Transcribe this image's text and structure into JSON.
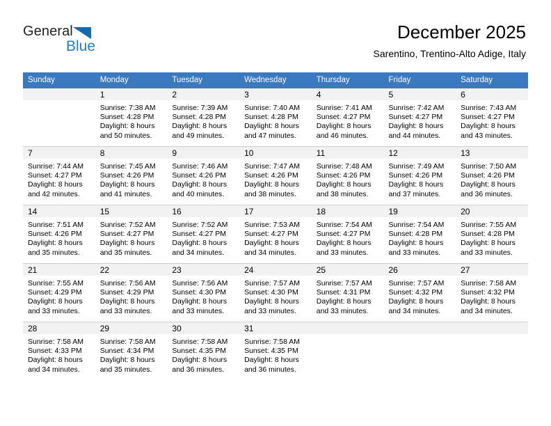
{
  "brand": {
    "name_part1": "General",
    "name_part2": "Blue",
    "triangle_color": "#1268b3",
    "blue_color": "#1b7fd4"
  },
  "header": {
    "title": "December 2025",
    "subtitle": "Sarentino, Trentino-Alto Adige, Italy"
  },
  "theme": {
    "header_row_bg": "#3a78bf",
    "daynum_band_bg": "#f1f1f1",
    "grid_line": "#d2d2d2",
    "text": "#000000"
  },
  "weekday_headers": [
    "Sunday",
    "Monday",
    "Tuesday",
    "Wednesday",
    "Thursday",
    "Friday",
    "Saturday"
  ],
  "weeks": [
    [
      {
        "day": "",
        "sunrise": "",
        "sunset": "",
        "daylight_line1": "",
        "daylight_line2": ""
      },
      {
        "day": "1",
        "sunrise": "Sunrise: 7:38 AM",
        "sunset": "Sunset: 4:28 PM",
        "daylight_line1": "Daylight: 8 hours",
        "daylight_line2": "and 50 minutes."
      },
      {
        "day": "2",
        "sunrise": "Sunrise: 7:39 AM",
        "sunset": "Sunset: 4:28 PM",
        "daylight_line1": "Daylight: 8 hours",
        "daylight_line2": "and 49 minutes."
      },
      {
        "day": "3",
        "sunrise": "Sunrise: 7:40 AM",
        "sunset": "Sunset: 4:28 PM",
        "daylight_line1": "Daylight: 8 hours",
        "daylight_line2": "and 47 minutes."
      },
      {
        "day": "4",
        "sunrise": "Sunrise: 7:41 AM",
        "sunset": "Sunset: 4:27 PM",
        "daylight_line1": "Daylight: 8 hours",
        "daylight_line2": "and 46 minutes."
      },
      {
        "day": "5",
        "sunrise": "Sunrise: 7:42 AM",
        "sunset": "Sunset: 4:27 PM",
        "daylight_line1": "Daylight: 8 hours",
        "daylight_line2": "and 44 minutes."
      },
      {
        "day": "6",
        "sunrise": "Sunrise: 7:43 AM",
        "sunset": "Sunset: 4:27 PM",
        "daylight_line1": "Daylight: 8 hours",
        "daylight_line2": "and 43 minutes."
      }
    ],
    [
      {
        "day": "7",
        "sunrise": "Sunrise: 7:44 AM",
        "sunset": "Sunset: 4:27 PM",
        "daylight_line1": "Daylight: 8 hours",
        "daylight_line2": "and 42 minutes."
      },
      {
        "day": "8",
        "sunrise": "Sunrise: 7:45 AM",
        "sunset": "Sunset: 4:26 PM",
        "daylight_line1": "Daylight: 8 hours",
        "daylight_line2": "and 41 minutes."
      },
      {
        "day": "9",
        "sunrise": "Sunrise: 7:46 AM",
        "sunset": "Sunset: 4:26 PM",
        "daylight_line1": "Daylight: 8 hours",
        "daylight_line2": "and 40 minutes."
      },
      {
        "day": "10",
        "sunrise": "Sunrise: 7:47 AM",
        "sunset": "Sunset: 4:26 PM",
        "daylight_line1": "Daylight: 8 hours",
        "daylight_line2": "and 38 minutes."
      },
      {
        "day": "11",
        "sunrise": "Sunrise: 7:48 AM",
        "sunset": "Sunset: 4:26 PM",
        "daylight_line1": "Daylight: 8 hours",
        "daylight_line2": "and 38 minutes."
      },
      {
        "day": "12",
        "sunrise": "Sunrise: 7:49 AM",
        "sunset": "Sunset: 4:26 PM",
        "daylight_line1": "Daylight: 8 hours",
        "daylight_line2": "and 37 minutes."
      },
      {
        "day": "13",
        "sunrise": "Sunrise: 7:50 AM",
        "sunset": "Sunset: 4:26 PM",
        "daylight_line1": "Daylight: 8 hours",
        "daylight_line2": "and 36 minutes."
      }
    ],
    [
      {
        "day": "14",
        "sunrise": "Sunrise: 7:51 AM",
        "sunset": "Sunset: 4:26 PM",
        "daylight_line1": "Daylight: 8 hours",
        "daylight_line2": "and 35 minutes."
      },
      {
        "day": "15",
        "sunrise": "Sunrise: 7:52 AM",
        "sunset": "Sunset: 4:27 PM",
        "daylight_line1": "Daylight: 8 hours",
        "daylight_line2": "and 35 minutes."
      },
      {
        "day": "16",
        "sunrise": "Sunrise: 7:52 AM",
        "sunset": "Sunset: 4:27 PM",
        "daylight_line1": "Daylight: 8 hours",
        "daylight_line2": "and 34 minutes."
      },
      {
        "day": "17",
        "sunrise": "Sunrise: 7:53 AM",
        "sunset": "Sunset: 4:27 PM",
        "daylight_line1": "Daylight: 8 hours",
        "daylight_line2": "and 34 minutes."
      },
      {
        "day": "18",
        "sunrise": "Sunrise: 7:54 AM",
        "sunset": "Sunset: 4:27 PM",
        "daylight_line1": "Daylight: 8 hours",
        "daylight_line2": "and 33 minutes."
      },
      {
        "day": "19",
        "sunrise": "Sunrise: 7:54 AM",
        "sunset": "Sunset: 4:28 PM",
        "daylight_line1": "Daylight: 8 hours",
        "daylight_line2": "and 33 minutes."
      },
      {
        "day": "20",
        "sunrise": "Sunrise: 7:55 AM",
        "sunset": "Sunset: 4:28 PM",
        "daylight_line1": "Daylight: 8 hours",
        "daylight_line2": "and 33 minutes."
      }
    ],
    [
      {
        "day": "21",
        "sunrise": "Sunrise: 7:55 AM",
        "sunset": "Sunset: 4:29 PM",
        "daylight_line1": "Daylight: 8 hours",
        "daylight_line2": "and 33 minutes."
      },
      {
        "day": "22",
        "sunrise": "Sunrise: 7:56 AM",
        "sunset": "Sunset: 4:29 PM",
        "daylight_line1": "Daylight: 8 hours",
        "daylight_line2": "and 33 minutes."
      },
      {
        "day": "23",
        "sunrise": "Sunrise: 7:56 AM",
        "sunset": "Sunset: 4:30 PM",
        "daylight_line1": "Daylight: 8 hours",
        "daylight_line2": "and 33 minutes."
      },
      {
        "day": "24",
        "sunrise": "Sunrise: 7:57 AM",
        "sunset": "Sunset: 4:30 PM",
        "daylight_line1": "Daylight: 8 hours",
        "daylight_line2": "and 33 minutes."
      },
      {
        "day": "25",
        "sunrise": "Sunrise: 7:57 AM",
        "sunset": "Sunset: 4:31 PM",
        "daylight_line1": "Daylight: 8 hours",
        "daylight_line2": "and 33 minutes."
      },
      {
        "day": "26",
        "sunrise": "Sunrise: 7:57 AM",
        "sunset": "Sunset: 4:32 PM",
        "daylight_line1": "Daylight: 8 hours",
        "daylight_line2": "and 34 minutes."
      },
      {
        "day": "27",
        "sunrise": "Sunrise: 7:58 AM",
        "sunset": "Sunset: 4:32 PM",
        "daylight_line1": "Daylight: 8 hours",
        "daylight_line2": "and 34 minutes."
      }
    ],
    [
      {
        "day": "28",
        "sunrise": "Sunrise: 7:58 AM",
        "sunset": "Sunset: 4:33 PM",
        "daylight_line1": "Daylight: 8 hours",
        "daylight_line2": "and 34 minutes."
      },
      {
        "day": "29",
        "sunrise": "Sunrise: 7:58 AM",
        "sunset": "Sunset: 4:34 PM",
        "daylight_line1": "Daylight: 8 hours",
        "daylight_line2": "and 35 minutes."
      },
      {
        "day": "30",
        "sunrise": "Sunrise: 7:58 AM",
        "sunset": "Sunset: 4:35 PM",
        "daylight_line1": "Daylight: 8 hours",
        "daylight_line2": "and 36 minutes."
      },
      {
        "day": "31",
        "sunrise": "Sunrise: 7:58 AM",
        "sunset": "Sunset: 4:35 PM",
        "daylight_line1": "Daylight: 8 hours",
        "daylight_line2": "and 36 minutes."
      },
      {
        "day": "",
        "sunrise": "",
        "sunset": "",
        "daylight_line1": "",
        "daylight_line2": ""
      },
      {
        "day": "",
        "sunrise": "",
        "sunset": "",
        "daylight_line1": "",
        "daylight_line2": ""
      },
      {
        "day": "",
        "sunrise": "",
        "sunset": "",
        "daylight_line1": "",
        "daylight_line2": ""
      }
    ]
  ]
}
